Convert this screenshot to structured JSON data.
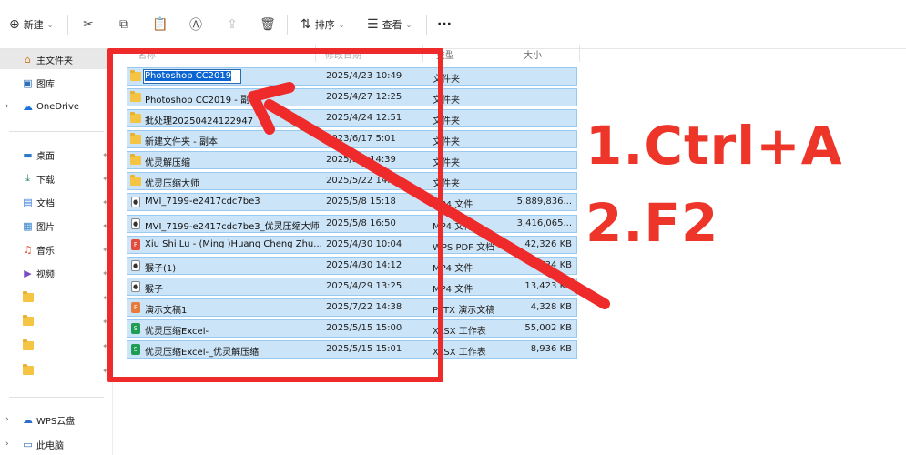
{
  "toolbar": {
    "new_label": "新建",
    "sort_label": "排序",
    "view_label": "查看",
    "more_label": "···"
  },
  "headers": {
    "name": "名称",
    "date": "修改日期",
    "type": "类型",
    "size": "大小"
  },
  "sidebar": {
    "items": [
      {
        "label": "主文件夹",
        "icon": "home-icon"
      },
      {
        "label": "图库",
        "icon": "gallery-icon"
      },
      {
        "label": "OneDrive",
        "icon": "cloud-icon"
      },
      {
        "label": "桌面",
        "icon": "desktop-icon"
      },
      {
        "label": "下载",
        "icon": "download-icon"
      },
      {
        "label": "文档",
        "icon": "document-icon"
      },
      {
        "label": "图片",
        "icon": "picture-icon"
      },
      {
        "label": "音乐",
        "icon": "music-icon"
      },
      {
        "label": "视频",
        "icon": "video-icon"
      },
      {
        "label": "WPS云盘",
        "icon": "wps-cloud-icon"
      },
      {
        "label": "此电脑",
        "icon": "computer-icon"
      }
    ]
  },
  "files": [
    {
      "name": "Photoshop CC2019",
      "date": "2025/4/23 10:49",
      "type": "文件夹",
      "size": ""
    },
    {
      "name": "Photoshop CC2019 - 副",
      "date": "2025/4/27 12:25",
      "type": "文件夹",
      "size": ""
    },
    {
      "name": "批处理20250424122947",
      "date": "2025/4/24 12:51",
      "type": "文件夹",
      "size": ""
    },
    {
      "name": "新建文件夹 - 副本",
      "date": "2023/6/17 5:01",
      "type": "文件夹",
      "size": ""
    },
    {
      "name": "优灵解压缩",
      "date": "2025/5/6 14:39",
      "type": "文件夹",
      "size": ""
    },
    {
      "name": "优灵压缩大师",
      "date": "2025/5/22 14:2",
      "type": "文件夹",
      "size": ""
    },
    {
      "name": "MVI_7199-e2417cdc7be3",
      "date": "2025/5/8 15:18",
      "type": "MP4 文件",
      "size": "5,889,836..."
    },
    {
      "name": "MVI_7199-e2417cdc7be3_优灵压缩大师",
      "date": "2025/5/8 16:50",
      "type": "MP4 文件",
      "size": "3,416,065..."
    },
    {
      "name": "Xiu Shi Lu - (Ming )Huang Cheng Zhu...",
      "date": "2025/4/30 10:04",
      "type": "WPS PDF 文档",
      "size": "42,326 KB"
    },
    {
      "name": "猴子(1)",
      "date": "2025/4/30 14:12",
      "type": "MP4 文件",
      "size": "734 KB"
    },
    {
      "name": "猴子",
      "date": "2025/4/29 13:25",
      "type": "MP4 文件",
      "size": "13,423 KB"
    },
    {
      "name": "演示文稿1",
      "date": "2025/7/22 14:38",
      "type": "PPTX 演示文稿",
      "size": "4,328 KB"
    },
    {
      "name": "优灵压缩Excel-",
      "date": "2025/5/15 15:00",
      "type": "XLSX 工作表",
      "size": "55,002 KB"
    },
    {
      "name": "优灵压缩Excel-_优灵解压缩",
      "date": "2025/5/15 15:01",
      "type": "XLSX 工作表",
      "size": "8,936 KB"
    }
  ],
  "overlay": {
    "step1": "1.Ctrl+A",
    "step2": "2.F2"
  },
  "colors": {
    "selection": "#cce4f7",
    "selection_border": "#99c9ef",
    "annotation_red": "#ee2a2a"
  }
}
